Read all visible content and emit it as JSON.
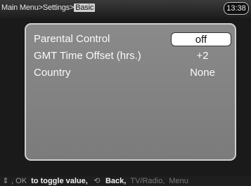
{
  "header": {
    "breadcrumb_path": "Main Menu>Settings>",
    "breadcrumb_current": "Basic",
    "clock": "13:38"
  },
  "settings": [
    {
      "label": "Parental Control",
      "value": "off",
      "selected": true
    },
    {
      "label": "GMT Time Offset (hrs.)",
      "value": "+2",
      "selected": false
    },
    {
      "label": "Country",
      "value": "None",
      "selected": false
    }
  ],
  "help": {
    "updown_icon": "up-down-arrows-icon",
    "ok_text": ", OK",
    "toggle_text": "to toggle value,",
    "back_icon": "back-arrow-icon",
    "back_text": "Back,",
    "tvradio_text": "TV/Radio,",
    "menu_text": "Menu"
  },
  "colors": {
    "panel": "#838383",
    "panel_border": "#cfcfcf",
    "background": "#1a1a1a",
    "selected_value_bg": "#ffffff"
  }
}
